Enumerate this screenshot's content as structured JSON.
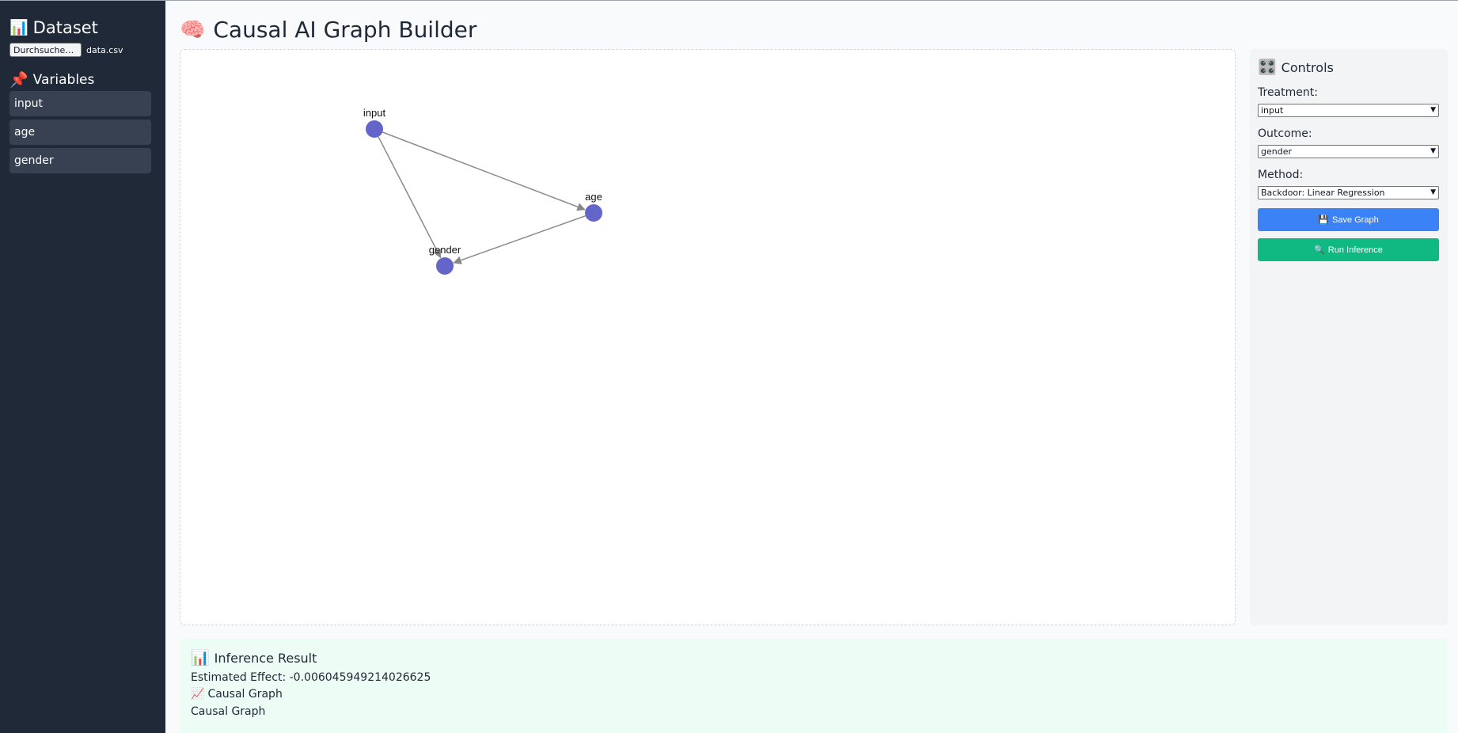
{
  "sidebar": {
    "title_icon": "bar-chart-icon",
    "title": "Dataset",
    "file_button": "Durchsuchen...",
    "file_name": "data.csv",
    "variables_icon": "pushpin-icon",
    "variables_title": "Variables",
    "variables": [
      "input",
      "age",
      "gender"
    ]
  },
  "header": {
    "icon": "brain-icon",
    "title": "Causal AI Graph Builder"
  },
  "graph": {
    "nodes": [
      {
        "id": "input",
        "label": "input"
      },
      {
        "id": "age",
        "label": "age"
      },
      {
        "id": "gender",
        "label": "gender"
      }
    ],
    "edges": [
      {
        "from": "input",
        "to": "age"
      },
      {
        "from": "input",
        "to": "gender"
      },
      {
        "from": "age",
        "to": "gender"
      }
    ],
    "node_color": "#6366c8",
    "edge_color": "#888888"
  },
  "controls": {
    "icon": "control-knobs-icon",
    "title": "Controls",
    "treatment_label": "Treatment:",
    "treatment_value": "input",
    "outcome_label": "Outcome:",
    "outcome_value": "gender",
    "method_label": "Method:",
    "method_value": "Backdoor: Linear Regression",
    "save_icon": "floppy-disk-icon",
    "save_label": "Save Graph",
    "run_icon": "magnifier-icon",
    "run_label": "Run Inference"
  },
  "result": {
    "icon": "bar-chart-icon",
    "title": "Inference Result",
    "estimated_effect": "Estimated Effect: -0.006045949214026625",
    "graph_icon": "line-chart-icon",
    "graph_heading": "Causal Graph",
    "graph_text": "Causal Graph"
  },
  "colors": {
    "sidebar_bg": "#1f2937",
    "save_button": "#3b82f6",
    "run_button": "#10b981",
    "result_bg": "#ecfdf5"
  }
}
